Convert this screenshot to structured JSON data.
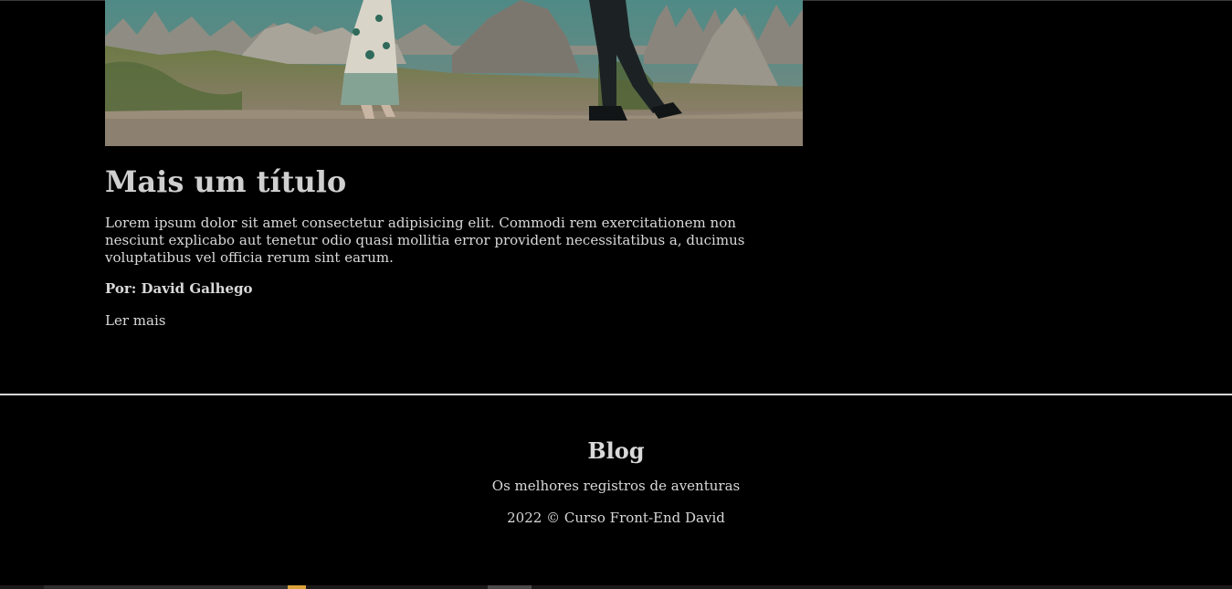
{
  "post": {
    "image_alt": "Casal caminhando entre formações rochosas",
    "title": "Mais um título",
    "body": "Lorem ipsum dolor sit amet consectetur adipisicing elit. Commodi rem exercitationem non nesciunt explicabo aut tenetur odio quasi mollitia error provident necessitatibus a, ducimus voluptatibus vel officia rerum sint earum.",
    "author": "Por: David Galhego",
    "read_more": "Ler mais"
  },
  "footer": {
    "title": "Blog",
    "tagline": "Os melhores registros de aventuras",
    "copyright": "2022 © Curso Front-End David"
  },
  "colors": {
    "background": "#000000",
    "text": "#d9d9d9",
    "divider": "#d7d7d7"
  }
}
